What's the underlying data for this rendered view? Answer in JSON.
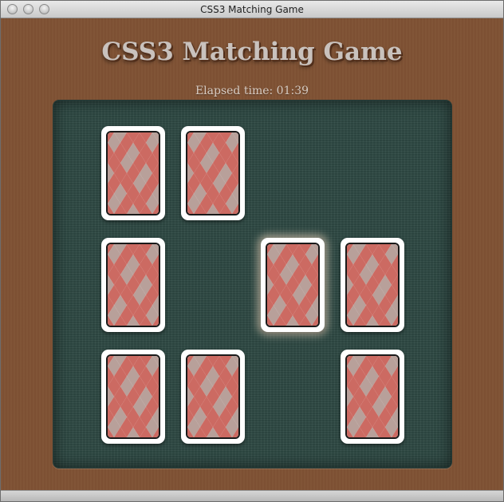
{
  "window": {
    "title": "CSS3 Matching Game"
  },
  "game": {
    "title": "CSS3 Matching Game",
    "elapsed_label": "Elapsed time: 01:39"
  },
  "cards": [
    {
      "id": "card-1",
      "face": "down",
      "selected": false,
      "row": 1,
      "col": 1
    },
    {
      "id": "card-2",
      "face": "down",
      "selected": false,
      "row": 1,
      "col": 2
    },
    {
      "id": "card-3",
      "face": "down",
      "selected": false,
      "row": 2,
      "col": 1
    },
    {
      "id": "card-4",
      "face": "down",
      "selected": true,
      "row": 2,
      "col": 3
    },
    {
      "id": "card-5",
      "face": "down",
      "selected": false,
      "row": 2,
      "col": 4
    },
    {
      "id": "card-6",
      "face": "down",
      "selected": false,
      "row": 3,
      "col": 1
    },
    {
      "id": "card-7",
      "face": "down",
      "selected": false,
      "row": 3,
      "col": 2
    },
    {
      "id": "card-8",
      "face": "down",
      "selected": false,
      "row": 3,
      "col": 4
    }
  ],
  "colors": {
    "background": "#7f5234",
    "table": "#2f4a44",
    "card_diamond": "#cc6a62",
    "card_diamond_alt": "#b8a09a"
  }
}
